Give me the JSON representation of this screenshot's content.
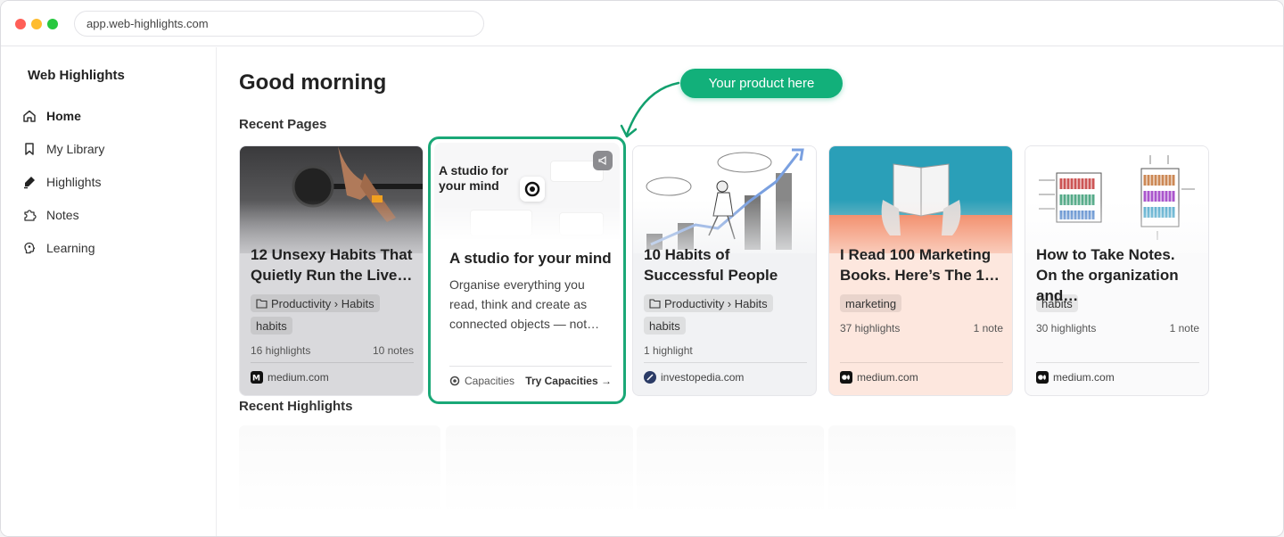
{
  "browser": {
    "url": "app.web-highlights.com"
  },
  "sidebar": {
    "brand": "Web Highlights",
    "items": [
      {
        "label": "Home",
        "icon": "home-icon",
        "active": true
      },
      {
        "label": "My Library",
        "icon": "bookmark-icon",
        "active": false
      },
      {
        "label": "Highlights",
        "icon": "highlighter-icon",
        "active": false
      },
      {
        "label": "Notes",
        "icon": "puzzle-icon",
        "active": false
      },
      {
        "label": "Learning",
        "icon": "brain-icon",
        "active": false
      }
    ]
  },
  "main": {
    "greeting": "Good morning",
    "recent_pages_title": "Recent Pages",
    "recent_highlights_title": "Recent Highlights"
  },
  "promo_badge": "Your product here",
  "promo": {
    "image_text": "A studio for your mind",
    "title": "A studio for your mind",
    "description": "Organise everything you read, think and create as connected objects — not…",
    "brand": "Capacities",
    "cta": "Try Capacities →"
  },
  "cards": [
    {
      "title": "12 Unsexy Habits That Quietly Run the Live…",
      "folder": "Productivity › Habits",
      "tags": [
        "habits"
      ],
      "highlights": "16 highlights",
      "notes": "10 notes",
      "source": "medium.com"
    },
    {
      "title": "10 Habits of Successful People",
      "folder": "Productivity › Habits",
      "tags": [
        "habits"
      ],
      "highlights": "1 highlight",
      "notes": "",
      "source": "investopedia.com"
    },
    {
      "title": "I Read 100 Marketing Books. Here’s The 1…",
      "folder": "",
      "tags": [
        "marketing"
      ],
      "highlights": "37 highlights",
      "notes": "1 note",
      "source": "medium.com"
    },
    {
      "title": "How to Take Notes. On the organization and…",
      "folder": "",
      "tags": [
        "habits"
      ],
      "highlights": "30 highlights",
      "notes": "1 note",
      "source": "medium.com"
    }
  ],
  "colors": {
    "accent": "#12b07a",
    "promo_border": "#1aa877"
  }
}
